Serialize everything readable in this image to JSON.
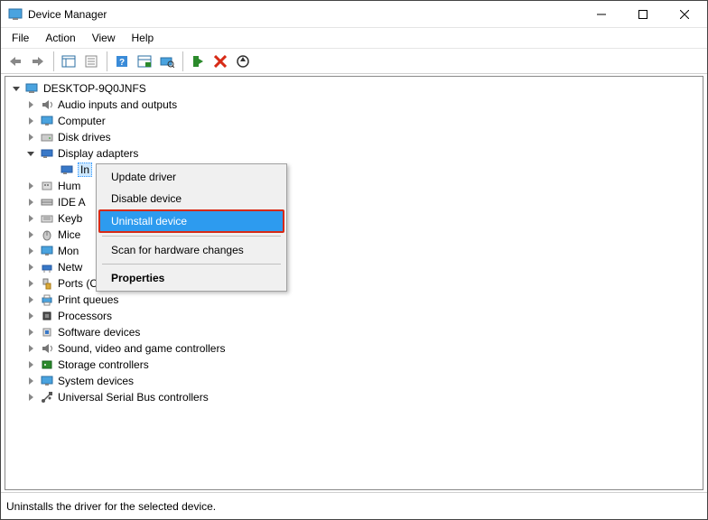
{
  "window": {
    "title": "Device Manager"
  },
  "menubar": {
    "file": "File",
    "action": "Action",
    "view": "View",
    "help": "Help"
  },
  "tree": {
    "root": "DESKTOP-9Q0JNFS",
    "audio": "Audio inputs and outputs",
    "computer": "Computer",
    "disk": "Disk drives",
    "display": "Display adapters",
    "display_child": "In",
    "human": "Hum",
    "ide": "IDE A",
    "keyb": "Keyb",
    "mice": "Mice",
    "mon": "Mon",
    "netw": "Netw",
    "ports": "Ports (COM & LPT)",
    "print": "Print queues",
    "proc": "Processors",
    "softdev": "Software devices",
    "sound": "Sound, video and game controllers",
    "storage": "Storage controllers",
    "system": "System devices",
    "usb": "Universal Serial Bus controllers"
  },
  "context_menu": {
    "update": "Update driver",
    "disable": "Disable device",
    "uninstall": "Uninstall device",
    "scan": "Scan for hardware changes",
    "properties": "Properties"
  },
  "statusbar": {
    "text": "Uninstalls the driver for the selected device."
  }
}
